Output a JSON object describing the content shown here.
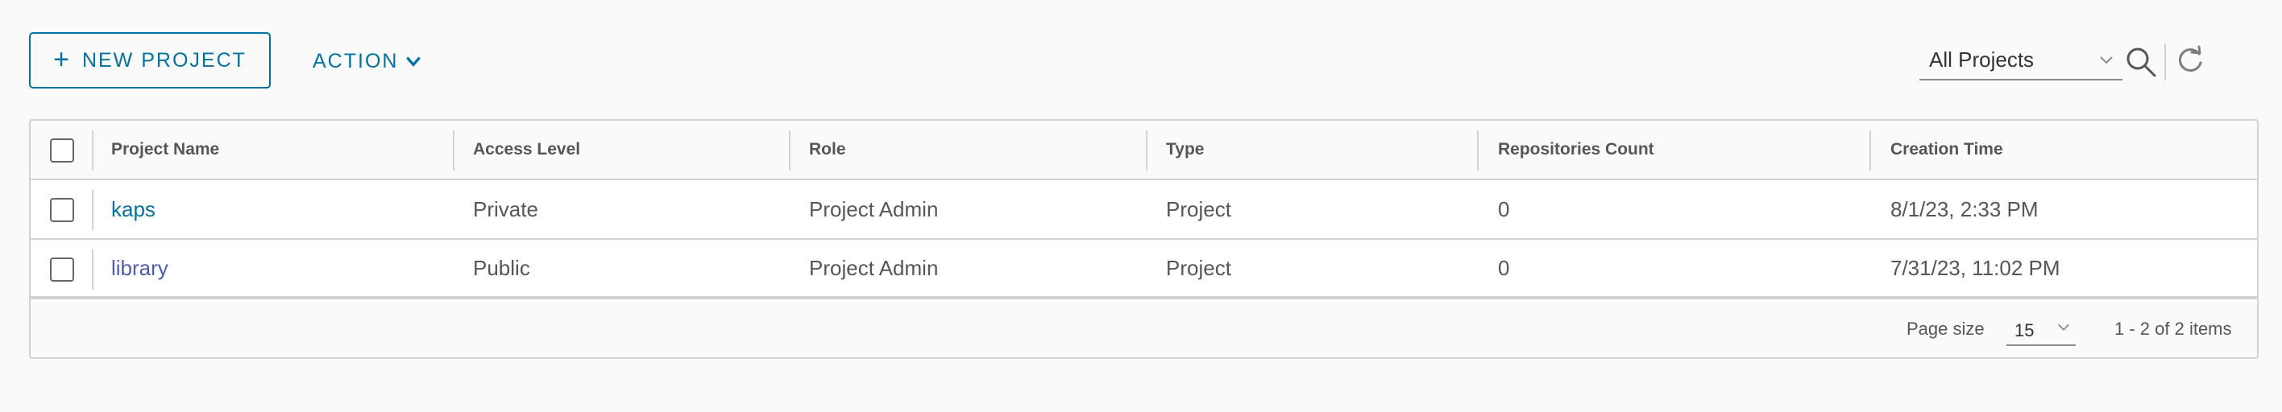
{
  "toolbar": {
    "new_project_label": "NEW PROJECT",
    "action_label": "ACTION",
    "filter_selected": "All Projects"
  },
  "table": {
    "columns": [
      "Project Name",
      "Access Level",
      "Role",
      "Type",
      "Repositories Count",
      "Creation Time"
    ],
    "rows": [
      {
        "name": "kaps",
        "access": "Private",
        "role": "Project Admin",
        "type": "Project",
        "repos": "0",
        "created": "8/1/23, 2:33 PM"
      },
      {
        "name": "library",
        "access": "Public",
        "role": "Project Admin",
        "type": "Project",
        "repos": "0",
        "created": "7/31/23, 11:02 PM"
      }
    ]
  },
  "footer": {
    "page_size_label": "Page size",
    "page_size_value": "15",
    "item_count": "1 - 2 of 2 items"
  },
  "colors": {
    "accent": "#0072a3",
    "link_visited": "#4f5bb0",
    "border": "#d2d2d2",
    "text": "#565656"
  },
  "icons": {
    "plus": "plus-icon",
    "action_chevron": "chevron-down-icon",
    "search": "search-icon",
    "refresh": "refresh-icon"
  }
}
